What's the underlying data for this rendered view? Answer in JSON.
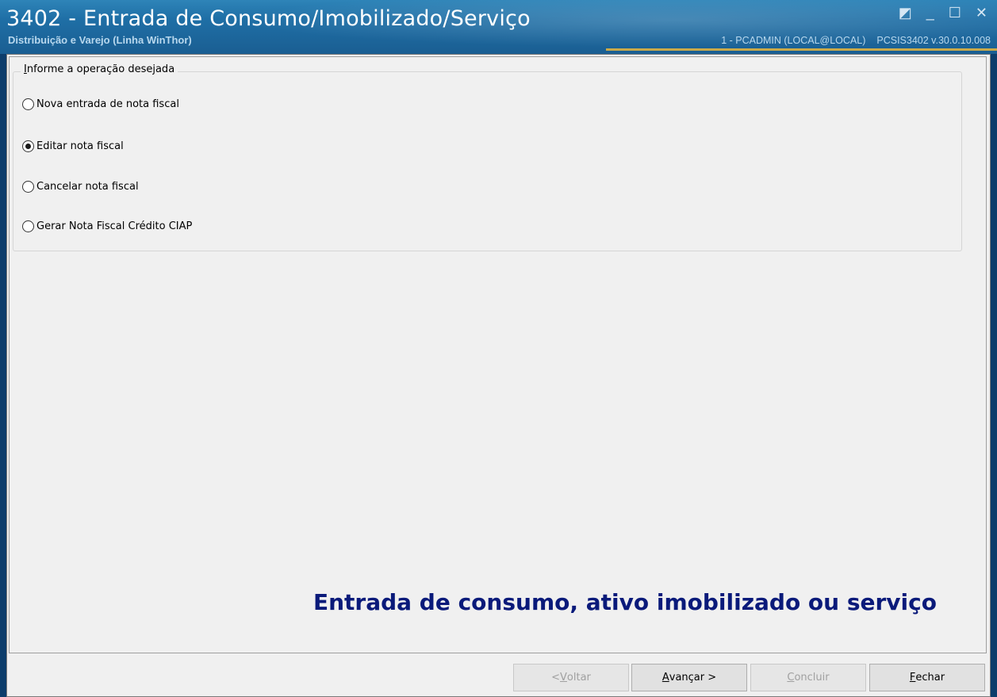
{
  "window": {
    "title": "3402 - Entrada de Consumo/Imobilizado/Serviço",
    "subtitle": "Distribuição e Varejo (Linha WinThor)",
    "user": "1 - PCADMIN (LOCAL@LOCAL)",
    "version": "PCSIS3402  v.30.0.10.008",
    "controls": {
      "restore": "◩",
      "minimize": "_",
      "maximize": "☐",
      "close": "✕"
    }
  },
  "group": {
    "legend_prefix": "I",
    "legend_rest": "nforme a operação desejada",
    "options": [
      {
        "label": "Nova entrada de nota fiscal",
        "checked": false
      },
      {
        "label": "Editar nota fiscal",
        "checked": true
      },
      {
        "label": "Cancelar nota fiscal",
        "checked": false
      },
      {
        "label": "Gerar Nota Fiscal Crédito CIAP",
        "checked": false
      }
    ]
  },
  "banner": "Entrada de consumo, ativo imobilizado ou serviço",
  "buttons": {
    "voltar": {
      "pre": "< ",
      "key": "V",
      "rest": "oltar",
      "enabled": false
    },
    "avancar": {
      "pre": "",
      "key": "A",
      "rest": "vançar >",
      "enabled": true
    },
    "concluir": {
      "pre": "",
      "key": "C",
      "rest": "oncluir",
      "enabled": false
    },
    "fechar": {
      "pre": "",
      "key": "F",
      "rest": "echar",
      "enabled": true
    }
  }
}
